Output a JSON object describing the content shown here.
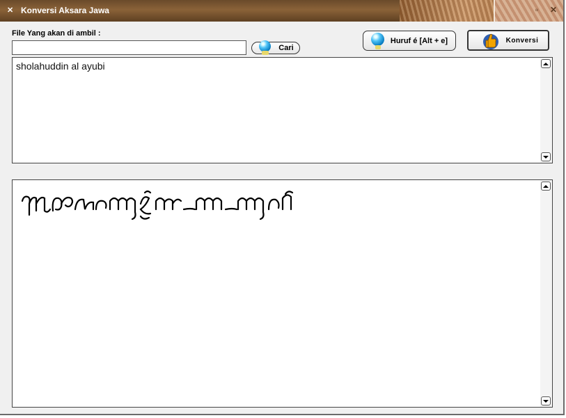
{
  "window": {
    "title": "Konversi Aksara Jawa"
  },
  "titlebar": {
    "app_icon": "app-menu-icon",
    "restore_glyph": "▫",
    "close_glyph": "✕"
  },
  "file_section": {
    "label": "File Yang akan di ambil :",
    "input_value": "",
    "browse_label": "Cari"
  },
  "toolbar": {
    "huruf_label": "Huruf é [Alt + e]",
    "konversi_label": "Konversi"
  },
  "input_text": "sholahuddin al ayubi",
  "output_text": {
    "script": "Javanese (Aksara Jawa) rendering"
  },
  "colors": {
    "titlebar": "#7a5532",
    "title_text": "#ffffff",
    "background": "#f0f0f0",
    "globe": "#0288d1",
    "thumb": "#f2a400"
  },
  "icons": [
    "globe-icon",
    "thumbs-up-icon",
    "scroll-up-icon",
    "scroll-down-icon",
    "close-icon",
    "restore-icon"
  ]
}
